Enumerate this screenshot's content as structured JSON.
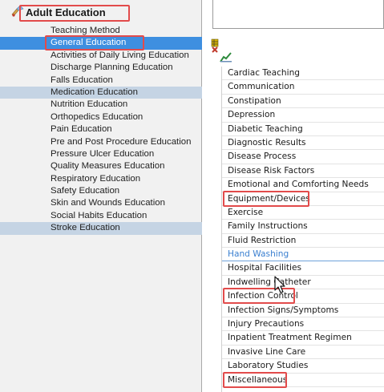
{
  "tree": {
    "root_label": "Adult Education",
    "items": [
      {
        "label": "Teaching Method",
        "state": "normal"
      },
      {
        "label": "General Education",
        "state": "selected",
        "highlighted": true
      },
      {
        "label": "Activities of Daily Living Education",
        "state": "normal"
      },
      {
        "label": "Discharge Planning Education",
        "state": "normal"
      },
      {
        "label": "Falls Education",
        "state": "normal"
      },
      {
        "label": "Medication Education",
        "state": "shaded"
      },
      {
        "label": "Nutrition Education",
        "state": "normal"
      },
      {
        "label": "Orthopedics Education",
        "state": "normal"
      },
      {
        "label": "Pain Education",
        "state": "normal"
      },
      {
        "label": "Pre and Post Procedure Education",
        "state": "normal"
      },
      {
        "label": "Pressure Ulcer Education",
        "state": "normal"
      },
      {
        "label": "Quality Measures Education",
        "state": "normal"
      },
      {
        "label": "Respiratory Education",
        "state": "normal"
      },
      {
        "label": "Safety Education",
        "state": "normal"
      },
      {
        "label": "Skin and Wounds Education",
        "state": "normal"
      },
      {
        "label": "Social Habits Education",
        "state": "normal"
      },
      {
        "label": "Stroke Education",
        "state": "shaded"
      }
    ]
  },
  "list": {
    "items": [
      {
        "label": "Cardiac Teaching"
      },
      {
        "label": "Communication"
      },
      {
        "label": "Constipation"
      },
      {
        "label": "Depression"
      },
      {
        "label": "Diabetic Teaching"
      },
      {
        "label": "Diagnostic Results"
      },
      {
        "label": "Disease Process"
      },
      {
        "label": "Disease Risk Factors"
      },
      {
        "label": "Emotional and Comforting Needs"
      },
      {
        "label": "Equipment/Devices",
        "highlighted": true
      },
      {
        "label": "Exercise"
      },
      {
        "label": "Family Instructions"
      },
      {
        "label": "Fluid Restriction"
      },
      {
        "label": "Hand Washing",
        "blue": true
      },
      {
        "label": "Hospital Facilities"
      },
      {
        "label": "Indwelling Catheter"
      },
      {
        "label": "Infection Control",
        "highlighted": true
      },
      {
        "label": "Infection Signs/Symptoms"
      },
      {
        "label": "Injury Precautions"
      },
      {
        "label": "Inpatient Treatment Regimen"
      },
      {
        "label": "Invasive Line Care"
      },
      {
        "label": "Laboratory Studies"
      },
      {
        "label": "Miscellaneous",
        "highlighted": true
      }
    ]
  },
  "colors": {
    "selected_bg": "#3e8fe0",
    "shaded_bg": "#c5d4e4",
    "highlight_box": "#e24b4b",
    "link_blue": "#3a7fd0"
  },
  "icons": {
    "root": "education-tree-icon",
    "toolbar": [
      "grid-tool-icon",
      "chart-tool-icon"
    ],
    "cursor": "mouse-pointer-icon"
  }
}
